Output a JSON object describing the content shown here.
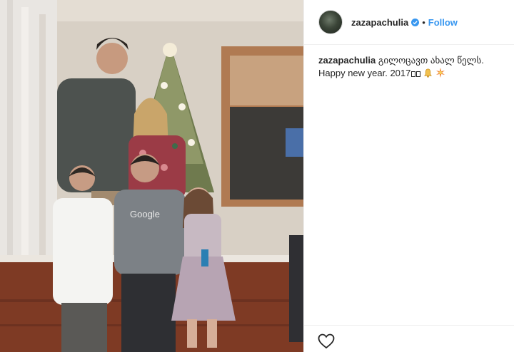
{
  "post": {
    "username": "zazapachulia",
    "dot": "•",
    "follow_label": "Follow",
    "caption_username": "zazapachulia",
    "caption_line1": "გილოცავთ ახალ წელს.",
    "caption_line2": "Happy new year. 2017"
  },
  "photo": {
    "shirt_text": "Google"
  },
  "icons": {
    "verified": "verified-badge-icon",
    "like": "heart-icon",
    "emoji_bell": "bell-icon",
    "emoji_spark": "sparkle-icon"
  },
  "colors": {
    "link": "#3897f0",
    "text": "#262626",
    "divider": "#efefef"
  }
}
